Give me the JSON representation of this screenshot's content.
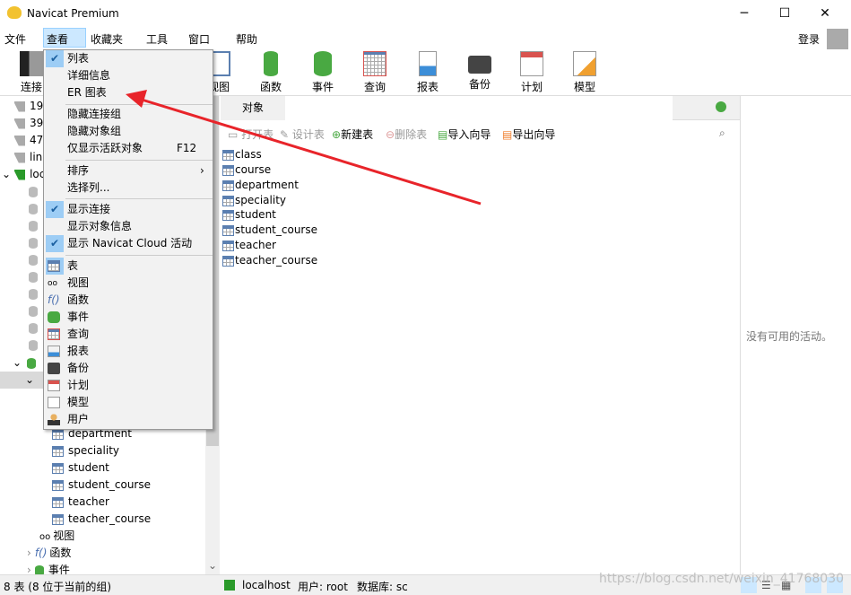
{
  "window": {
    "title": "Navicat Premium",
    "minimize": "─",
    "maximize": "☐",
    "close": "✕"
  },
  "menubar": {
    "items": [
      "文件",
      "查看",
      "收藏夹",
      "工具",
      "窗口",
      "帮助"
    ],
    "login": "登录"
  },
  "toolbar": {
    "items": [
      {
        "label": "连接",
        "icon": "connection-icon"
      },
      {
        "label": "视图",
        "icon": "view-icon"
      },
      {
        "label": "函数",
        "icon": "function-icon"
      },
      {
        "label": "事件",
        "icon": "event-icon"
      },
      {
        "label": "查询",
        "icon": "query-icon"
      },
      {
        "label": "报表",
        "icon": "report-icon"
      },
      {
        "label": "备份",
        "icon": "backup-icon"
      },
      {
        "label": "计划",
        "icon": "schedule-icon"
      },
      {
        "label": "模型",
        "icon": "model-icon"
      }
    ]
  },
  "sidebar": {
    "connections": [
      "19",
      "39",
      "47",
      "lin",
      "loc"
    ],
    "tables": [
      "department",
      "speciality",
      "student",
      "student_course",
      "teacher",
      "teacher_course"
    ],
    "views": "视图",
    "functions": "函数",
    "events": "事件"
  },
  "main": {
    "tab": "对象",
    "actions": {
      "open": "打开表",
      "design": "设计表",
      "new": "新建表",
      "delete": "删除表",
      "import": "导入向导",
      "export": "导出向导"
    },
    "objects": [
      "class",
      "course",
      "department",
      "speciality",
      "student",
      "student_course",
      "teacher",
      "teacher_course"
    ]
  },
  "right_panel": {
    "empty_text": "没有可用的活动。"
  },
  "dropdown": {
    "items": [
      {
        "label": "列表",
        "checked": true
      },
      {
        "label": "详细信息"
      },
      {
        "label": "ER 图表"
      },
      {
        "label": "隐藏连接组"
      },
      {
        "label": "隐藏对象组"
      },
      {
        "label": "仅显示活跃对象",
        "shortcut": "F12"
      },
      {
        "label": "排序",
        "submenu": "›"
      },
      {
        "label": "选择列..."
      },
      {
        "label": "显示连接",
        "checked": true
      },
      {
        "label": "显示对象信息"
      },
      {
        "label": "显示 Navicat Cloud 活动",
        "checked": true
      },
      {
        "label": "表",
        "icon": "table-icon",
        "selected": true
      },
      {
        "label": "视图",
        "icon": "view-icon"
      },
      {
        "label": "函数",
        "icon": "function-icon"
      },
      {
        "label": "事件",
        "icon": "event-icon"
      },
      {
        "label": "查询",
        "icon": "query-icon"
      },
      {
        "label": "报表",
        "icon": "report-icon"
      },
      {
        "label": "备份",
        "icon": "backup-icon"
      },
      {
        "label": "计划",
        "icon": "schedule-icon"
      },
      {
        "label": "模型",
        "icon": "model-icon"
      },
      {
        "label": "用户",
        "icon": "user-icon"
      }
    ]
  },
  "statusbar": {
    "left": "8 表 (8 位于当前的组)",
    "connection": "localhost",
    "user": "用户: root",
    "database": "数据库: sc"
  },
  "watermark": "https://blog.csdn.net/weixin_41768030",
  "colors": {
    "annotation_arrow": "#e8242a",
    "accent": "#9dcdf5",
    "green": "#49a942"
  }
}
